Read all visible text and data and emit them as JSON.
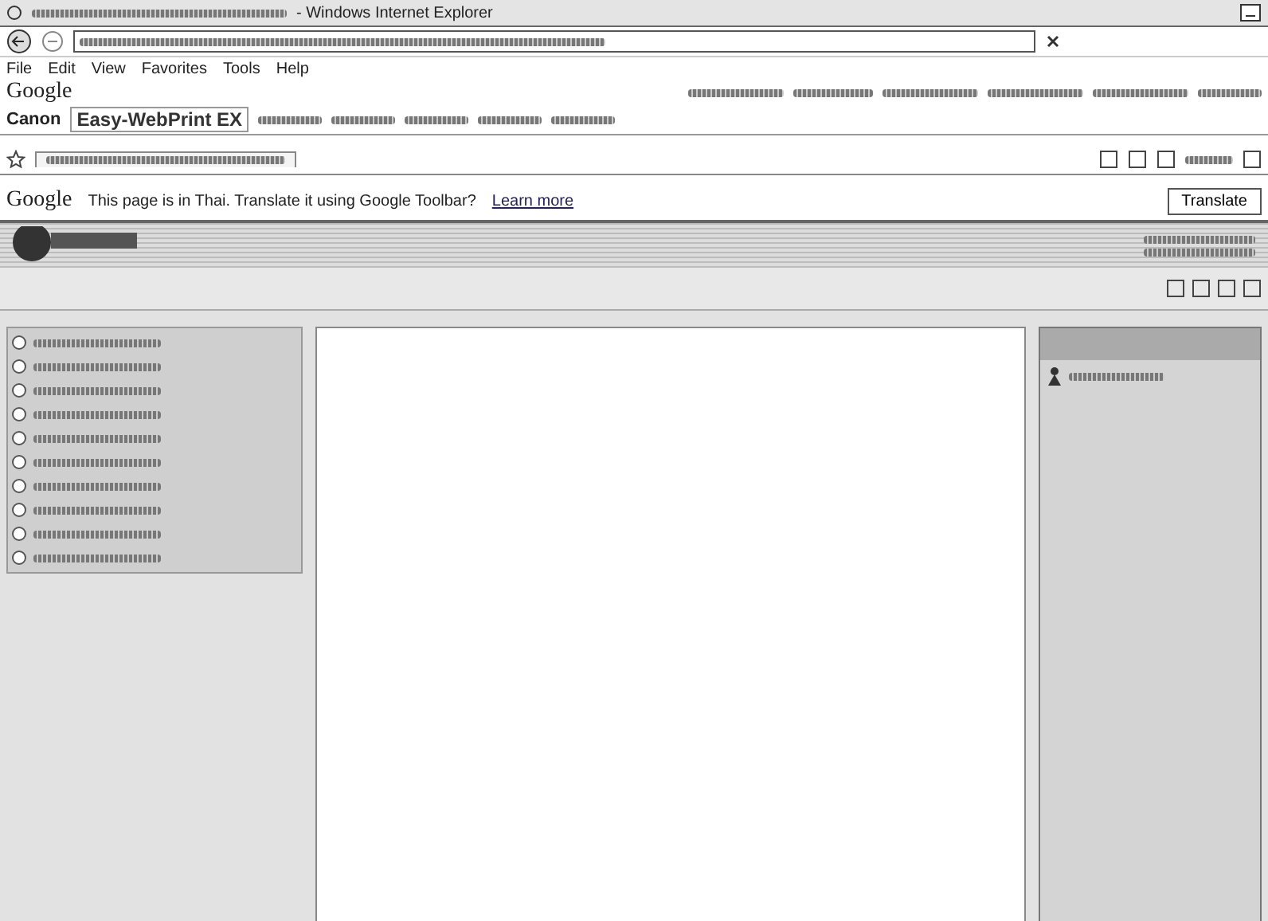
{
  "window": {
    "title": "- Windows Internet Explorer"
  },
  "menu_bar": [
    "File",
    "Edit",
    "View",
    "Favorites",
    "Tools",
    "Help"
  ],
  "google_toolbar": {
    "logo": "Google"
  },
  "canon_toolbar": {
    "brand": "Canon",
    "product": "Easy-WebPrint EX"
  },
  "translate_bar": {
    "logo": "Google",
    "message": "This page is in Thai. Translate it using Google Toolbar?",
    "link": "Learn more",
    "button": "Translate"
  },
  "sidebar": {
    "items": [
      {
        "kind": "link"
      },
      {
        "kind": "link"
      },
      {
        "kind": "link"
      },
      {
        "kind": "link"
      },
      {
        "kind": "link"
      },
      {
        "kind": "link"
      },
      {
        "kind": "link"
      },
      {
        "kind": "link"
      },
      {
        "kind": "link"
      },
      {
        "kind": "link"
      }
    ]
  }
}
